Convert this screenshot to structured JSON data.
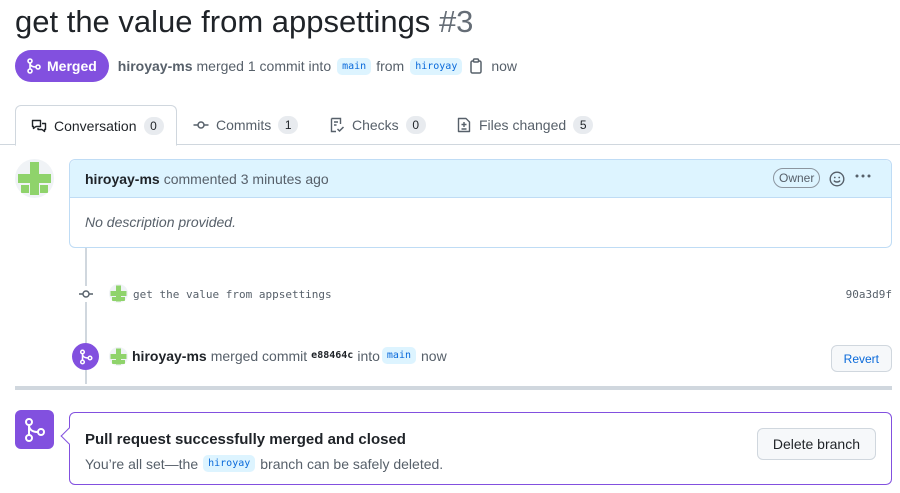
{
  "pr": {
    "title": "get the value from appsettings",
    "number": "#3",
    "state": "Merged",
    "author": "hiroyay-ms",
    "action_text": "merged 1 commit into",
    "base_branch": "main",
    "from_text": "from",
    "head_branch": "hiroyay",
    "time": "now"
  },
  "tabs": [
    {
      "label": "Conversation",
      "count": "0",
      "icon": "comment-discussion-icon"
    },
    {
      "label": "Commits",
      "count": "1",
      "icon": "git-commit-icon"
    },
    {
      "label": "Checks",
      "count": "0",
      "icon": "checklist-icon"
    },
    {
      "label": "Files changed",
      "count": "5",
      "icon": "file-diff-icon"
    }
  ],
  "comment": {
    "author": "hiroyay-ms",
    "meta": "commented 3 minutes ago",
    "badge": "Owner",
    "body": "No description provided."
  },
  "commit": {
    "message": "get the value from appsettings",
    "sha": "90a3d9f"
  },
  "merge_event": {
    "author": "hiroyay-ms",
    "text": "merged commit",
    "sha": "e88464c",
    "into_text": "into",
    "branch": "main",
    "time": "now",
    "revert_label": "Revert"
  },
  "merged_box": {
    "title": "Pull request successfully merged and closed",
    "sub_before": "You’re all set—the",
    "branch": "hiroyay",
    "sub_after": "branch can be safely deleted.",
    "delete_label": "Delete branch"
  },
  "colors": {
    "merged_purple": "#8250df",
    "link_blue": "#0969da",
    "comment_header_bg": "#ddf4ff",
    "identicon_green": "#8fd36b"
  }
}
